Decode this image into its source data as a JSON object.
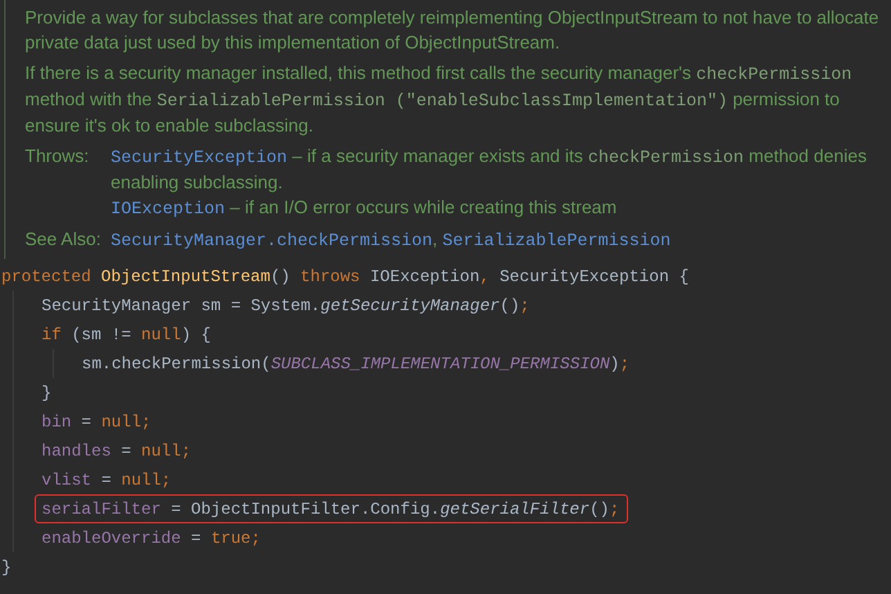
{
  "doc": {
    "paragraphs": [
      [
        {
          "kind": "text",
          "text": "Provide a way for subclasses that are completely reimplementing ObjectInputStream to not have to allocate private data just used by this implementation of ObjectInputStream."
        }
      ],
      [
        {
          "kind": "text",
          "text": "If there is a security manager installed, this method first calls the security manager's "
        },
        {
          "kind": "code",
          "text": "checkPermission"
        },
        {
          "kind": "text",
          "text": " method with the "
        },
        {
          "kind": "code",
          "text": "SerializablePermission (\"enableSubclassImplementation\")"
        },
        {
          "kind": "text",
          "text": " permission to ensure it's ok to enable subclassing."
        }
      ]
    ],
    "sections": [
      {
        "label": "Throws:",
        "items": [
          [
            {
              "kind": "link",
              "text": "SecurityException"
            },
            {
              "kind": "text",
              "text": " – if a security manager exists and its "
            },
            {
              "kind": "code",
              "text": "checkPermission"
            },
            {
              "kind": "text",
              "text": " method denies enabling subclassing."
            }
          ],
          [
            {
              "kind": "link",
              "text": "IOException"
            },
            {
              "kind": "text",
              "text": " – if an I/O error occurs while creating this stream"
            }
          ]
        ]
      },
      {
        "label": "See Also:",
        "items": [
          [
            {
              "kind": "link",
              "text": "SecurityManager.checkPermission"
            },
            {
              "kind": "text",
              "text": ", "
            },
            {
              "kind": "link",
              "text": "SerializablePermission"
            }
          ]
        ]
      }
    ]
  },
  "code": [
    {
      "highlighted": false,
      "tokens": [
        {
          "kind": "keyword",
          "text": "protected "
        },
        {
          "kind": "decl",
          "text": "ObjectInputStream"
        },
        {
          "kind": "plain",
          "text": "() "
        },
        {
          "kind": "keyword",
          "text": "throws "
        },
        {
          "kind": "plain",
          "text": "IOException"
        },
        {
          "kind": "keyword",
          "text": ", "
        },
        {
          "kind": "plain",
          "text": "SecurityException {"
        }
      ],
      "children": [
        {
          "highlighted": false,
          "tokens": [
            {
              "kind": "plain",
              "text": "SecurityManager sm = System."
            },
            {
              "kind": "static",
              "text": "getSecurityManager"
            },
            {
              "kind": "plain",
              "text": "()"
            },
            {
              "kind": "keyword",
              "text": ";"
            }
          ]
        },
        {
          "highlighted": false,
          "tokens": [
            {
              "kind": "keyword",
              "text": "if "
            },
            {
              "kind": "plain",
              "text": "(sm != "
            },
            {
              "kind": "keyword",
              "text": "null"
            },
            {
              "kind": "plain",
              "text": ") {"
            }
          ],
          "children": [
            {
              "highlighted": false,
              "tokens": [
                {
                  "kind": "plain",
                  "text": "sm.checkPermission("
                },
                {
                  "kind": "constant",
                  "text": "SUBCLASS_IMPLEMENTATION_PERMISSION"
                },
                {
                  "kind": "plain",
                  "text": ")"
                },
                {
                  "kind": "keyword",
                  "text": ";"
                }
              ]
            }
          ]
        },
        {
          "highlighted": false,
          "tokens": [
            {
              "kind": "plain",
              "text": "}"
            }
          ]
        },
        {
          "highlighted": false,
          "tokens": [
            {
              "kind": "field",
              "text": "bin"
            },
            {
              "kind": "plain",
              "text": " = "
            },
            {
              "kind": "keyword",
              "text": "null;"
            }
          ]
        },
        {
          "highlighted": false,
          "tokens": [
            {
              "kind": "field",
              "text": "handles"
            },
            {
              "kind": "plain",
              "text": " = "
            },
            {
              "kind": "keyword",
              "text": "null;"
            }
          ]
        },
        {
          "highlighted": false,
          "tokens": [
            {
              "kind": "field",
              "text": "vlist"
            },
            {
              "kind": "plain",
              "text": " = "
            },
            {
              "kind": "keyword",
              "text": "null;"
            }
          ]
        },
        {
          "highlighted": true,
          "tokens": [
            {
              "kind": "field",
              "text": "serialFilter"
            },
            {
              "kind": "plain",
              "text": " = ObjectInputFilter.Config."
            },
            {
              "kind": "static",
              "text": "getSerialFilter"
            },
            {
              "kind": "plain",
              "text": "()"
            },
            {
              "kind": "keyword",
              "text": ";"
            }
          ]
        },
        {
          "highlighted": false,
          "tokens": [
            {
              "kind": "field",
              "text": "enableOverride"
            },
            {
              "kind": "plain",
              "text": " = "
            },
            {
              "kind": "keyword",
              "text": "true;"
            }
          ]
        }
      ]
    },
    {
      "highlighted": false,
      "tokens": [
        {
          "kind": "plain",
          "text": "}"
        }
      ]
    }
  ]
}
